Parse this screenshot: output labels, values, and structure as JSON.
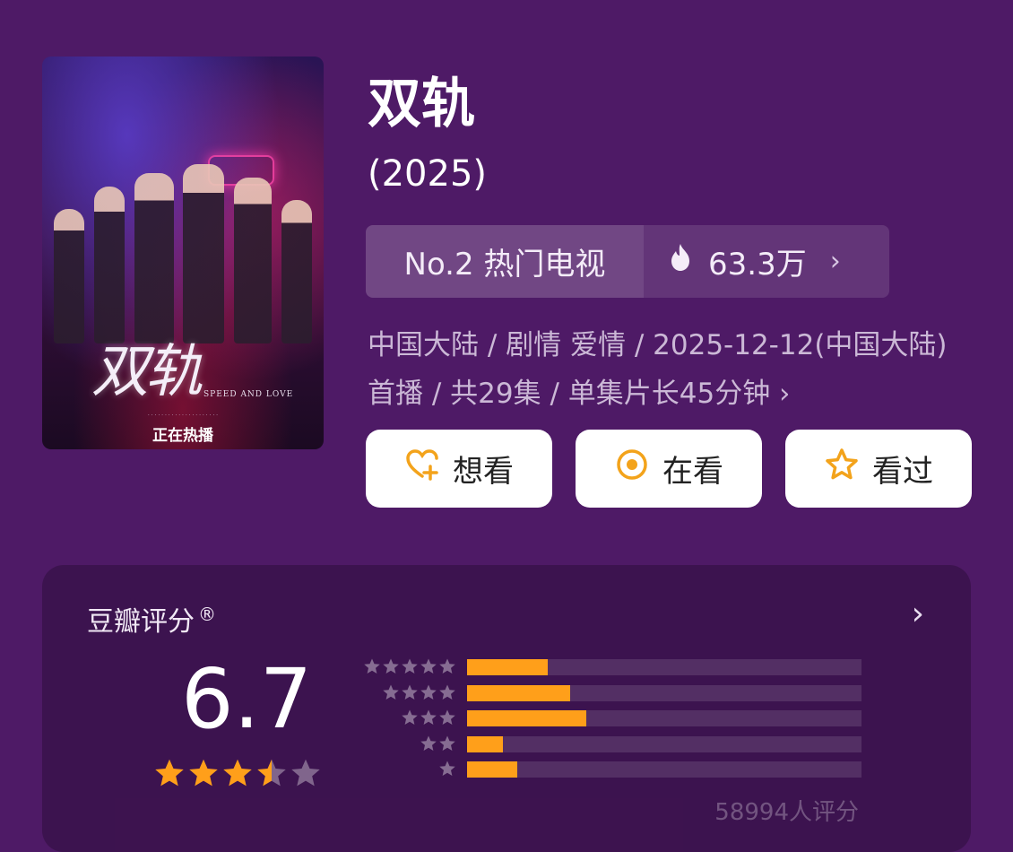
{
  "poster": {
    "logo_text": "双轨",
    "logo_subtitle": "SPEED AND LOVE",
    "status_text": "正在热播"
  },
  "show": {
    "title": "双轨",
    "year": "(2025)"
  },
  "rank": {
    "label": "No.2 热门电视",
    "heat": "63.3万",
    "icon": "fire-icon"
  },
  "meta": {
    "text": "中国大陆 / 剧情 爱情 / 2025-12-12(中国大陆)首播 / 共29集 / 单集片长45分钟 ›"
  },
  "actions": [
    {
      "label": "想看",
      "icon": "heart-plus-icon"
    },
    {
      "label": "在看",
      "icon": "target-icon"
    },
    {
      "label": "看过",
      "icon": "star-outline-icon"
    }
  ],
  "rating": {
    "title": "豆瓣评分",
    "trademark": "®",
    "score": "6.7",
    "stars": 3.5,
    "count_text": "58994人评分",
    "distribution": [
      {
        "stars": 5,
        "fraction": 0.205
      },
      {
        "stars": 4,
        "fraction": 0.262
      },
      {
        "stars": 3,
        "fraction": 0.302
      },
      {
        "stars": 2,
        "fraction": 0.09
      },
      {
        "stars": 1,
        "fraction": 0.128
      }
    ]
  },
  "colors": {
    "background": "#4e1a66",
    "accent": "#ff9f1a",
    "button_icon": "#f3a31b"
  }
}
